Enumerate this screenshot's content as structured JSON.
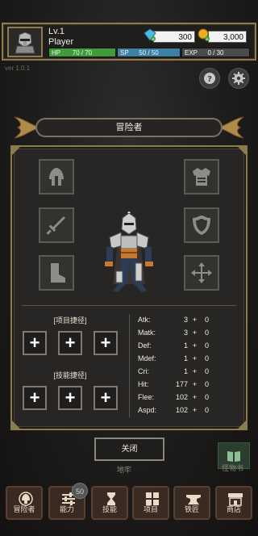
{
  "player": {
    "level": "Lv.1",
    "name": "Player",
    "hp": {
      "label": "HP",
      "value": "70 / 70",
      "fraction": 1.0
    },
    "sp": {
      "label": "SP",
      "value": "50 / 50",
      "fraction": 1.0
    },
    "exp": {
      "label": "EXP",
      "value": "0 / 30",
      "fraction": 0.0
    }
  },
  "currency": {
    "gems": "300",
    "gold": "3,000",
    "gem_color": "#4fb8e0",
    "gold_color": "#e8b020",
    "plus_color": "#3aa040"
  },
  "version": "ver 1.0.1",
  "top_buttons": {
    "help_icon": "question-icon",
    "settings_icon": "gear-icon"
  },
  "panel": {
    "title": "冒险者",
    "equipment": {
      "left": [
        "helmet-icon",
        "sword-icon",
        "boot-icon"
      ],
      "right": [
        "chest-armor-icon",
        "shield-icon",
        "cross-arrows-icon"
      ]
    },
    "item_shortcut_title": "[项目捷径]",
    "skill_shortcut_title": "[技能捷径]",
    "plus_symbol": "+",
    "stats": [
      {
        "name": "Atk:",
        "value": "3",
        "plus": "+",
        "bonus": "0"
      },
      {
        "name": "Matk:",
        "value": "3",
        "plus": "+",
        "bonus": "0"
      },
      {
        "name": "Def:",
        "value": "1",
        "plus": "+",
        "bonus": "0"
      },
      {
        "name": "Mdef:",
        "value": "1",
        "plus": "+",
        "bonus": "0"
      },
      {
        "name": "Cri:",
        "value": "1",
        "plus": "+",
        "bonus": "0"
      },
      {
        "name": "Hit:",
        "value": "177",
        "plus": "+",
        "bonus": "0"
      },
      {
        "name": "Flee:",
        "value": "102",
        "plus": "+",
        "bonus": "0"
      },
      {
        "name": "Aspd:",
        "value": "102",
        "plus": "+",
        "bonus": "0"
      }
    ]
  },
  "close_label": "关闭",
  "map_label": "地牢",
  "monster_book_label": "怪物书",
  "nav": [
    {
      "label": "冒险者",
      "icon": "helmet-icon"
    },
    {
      "label": "能力",
      "icon": "stats-icon",
      "badge": "50"
    },
    {
      "label": "技能",
      "icon": "hourglass-icon"
    },
    {
      "label": "项目",
      "icon": "inventory-icon"
    },
    {
      "label": "铁匠",
      "icon": "anvil-icon"
    },
    {
      "label": "商店",
      "icon": "shop-icon"
    }
  ]
}
